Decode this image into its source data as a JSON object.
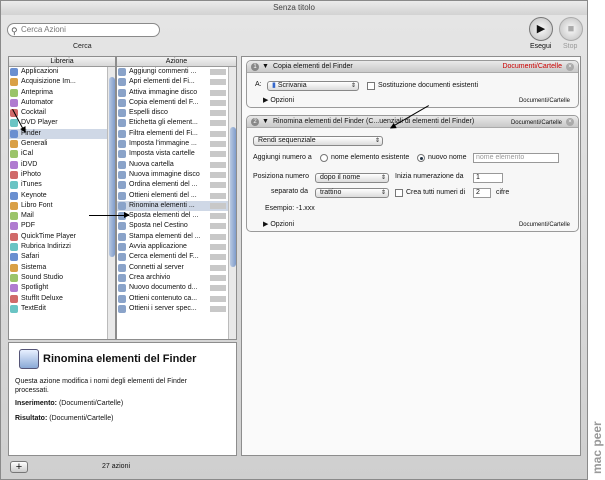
{
  "window": {
    "title": "Senza titolo"
  },
  "toolbar": {
    "search_placeholder": "Cerca Azioni",
    "search_label": "Cerca",
    "run_label": "Esegui",
    "stop_label": "Stop"
  },
  "library": {
    "header": "Libreria",
    "items": [
      {
        "label": "Applicazioni",
        "icon": "applications-folder-icon"
      },
      {
        "label": "Acquisizione Im...",
        "icon": "image-capture-icon"
      },
      {
        "label": "Anteprima",
        "icon": "preview-icon"
      },
      {
        "label": "Automator",
        "icon": "automator-icon"
      },
      {
        "label": "Cocktail",
        "icon": "cocktail-icon"
      },
      {
        "label": "DVD Player",
        "icon": "dvd-player-icon"
      },
      {
        "label": "Finder",
        "icon": "finder-icon",
        "selected": true
      },
      {
        "label": "Generali",
        "icon": "general-icon"
      },
      {
        "label": "iCal",
        "icon": "ical-icon"
      },
      {
        "label": "iDVD",
        "icon": "idvd-icon"
      },
      {
        "label": "iPhoto",
        "icon": "iphoto-icon"
      },
      {
        "label": "iTunes",
        "icon": "itunes-icon"
      },
      {
        "label": "Keynote",
        "icon": "keynote-icon"
      },
      {
        "label": "Libro Font",
        "icon": "font-book-icon"
      },
      {
        "label": "Mail",
        "icon": "mail-icon"
      },
      {
        "label": "PDF",
        "icon": "pdf-icon"
      },
      {
        "label": "QuickTime Player",
        "icon": "quicktime-icon"
      },
      {
        "label": "Rubrica Indirizzi",
        "icon": "address-book-icon"
      },
      {
        "label": "Safari",
        "icon": "safari-icon"
      },
      {
        "label": "Sistema",
        "icon": "system-icon"
      },
      {
        "label": "Sound Studio",
        "icon": "sound-studio-icon"
      },
      {
        "label": "Spotlight",
        "icon": "spotlight-icon"
      },
      {
        "label": "StuffIt Deluxe",
        "icon": "stuffit-icon"
      },
      {
        "label": "TextEdit",
        "icon": "textedit-icon"
      }
    ]
  },
  "actions_list": {
    "header": "Azione",
    "items": [
      "Aggiungi commenti ...",
      "Apri elementi del Fi...",
      "Attiva immagine disco",
      "Copia elementi del F...",
      "Espelli disco",
      "Etichetta gli element...",
      "Filtra elementi del Fi...",
      "Imposta l'immagine ...",
      "Imposta vista cartelle",
      "Nuova cartella",
      "Nuova immagine disco",
      "Ordina elementi del ...",
      "Ottieni elementi del ...",
      "Rinomina elementi ...",
      "Sposta elementi del ...",
      "Sposta nel Cestino",
      "Stampa elementi del ...",
      "Avvia applicazione",
      "Cerca elementi del F...",
      "Connetti al server",
      "Crea  archivio",
      "Nuovo documento d...",
      "Ottieni contenuto ca...",
      "Ottieni i server spec..."
    ],
    "selected_index": 13
  },
  "description": {
    "title": "Rinomina elementi del Finder",
    "body": "Questa azione modifica i nomi degli elementi del Finder processati.",
    "input_label": "Inserimento:",
    "input_value": "(Documenti/Cartelle)",
    "result_label": "Risultato:",
    "result_value": "(Documenti/Cartelle)"
  },
  "workflow": {
    "action1": {
      "number": "1",
      "title": "Copia elementi del Finder",
      "input_type": "Documenti/Cartelle",
      "to_label": "A:",
      "to_value": "Scrivania",
      "replace_label": "Sostituzione documenti esistenti",
      "options_label": "Opzioni",
      "output_type": "Documenti/Cartelle"
    },
    "action2": {
      "number": "2",
      "title": "Rinomina elementi del Finder (C...uenziali di elementi del Finder)",
      "output_type_head": "Documenti/Cartelle",
      "mode_value": "Rendi sequenziale",
      "add_number_label": "Aggiungi numero a",
      "radio_existing": "nome elemento esistente",
      "radio_new": "nuovo nome",
      "new_name_placeholder": "nome elemento",
      "position_label": "Posiziona numero",
      "position_value": "dopo il nome",
      "start_label": "Inizia numerazione  da",
      "start_value": "1",
      "separator_label": "separato da",
      "separator_value": "trattino",
      "all_digits_label": "Crea tutti numeri di",
      "digits_value": "2",
      "digits_unit": "cifre",
      "example": "Esempio:  -1.xxx",
      "options_label": "Opzioni",
      "output_type": "Documenti/Cartelle"
    }
  },
  "status": {
    "count": "27 azioni"
  },
  "watermark": "mac peer"
}
